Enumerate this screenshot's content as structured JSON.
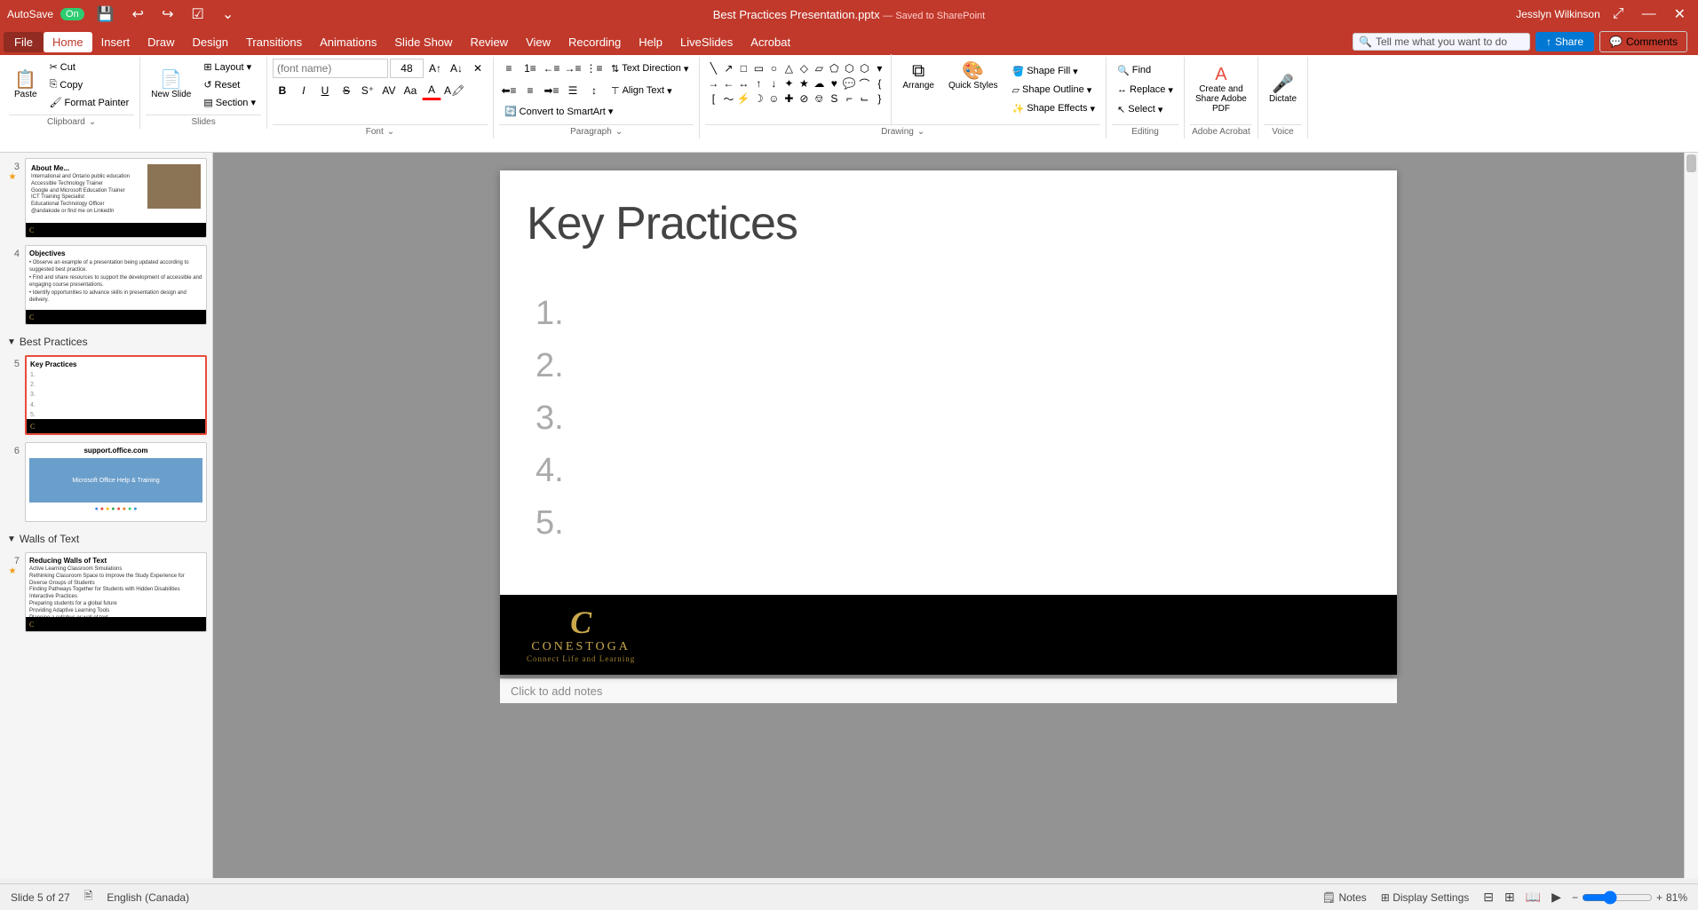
{
  "titlebar": {
    "autosave_label": "AutoSave",
    "autosave_state": "On",
    "file_title": "Best Practices Presentation.pptx",
    "saved_state": "Saved to SharePoint",
    "user_name": "Jesslyn Wilkinson"
  },
  "menu": {
    "file": "File",
    "home": "Home",
    "insert": "Insert",
    "draw": "Draw",
    "design": "Design",
    "transitions": "Transitions",
    "animations": "Animations",
    "slideshow": "Slide Show",
    "review": "Review",
    "view": "View",
    "recording": "Recording",
    "help": "Help",
    "liveslides": "LiveSlides",
    "acrobat": "Acrobat"
  },
  "ribbon": {
    "search_placeholder": "Tell me what you want to do",
    "groups": {
      "clipboard": {
        "label": "Clipboard",
        "paste": "Paste",
        "cut": "Cut",
        "copy": "Copy",
        "format_painter": "Format Painter"
      },
      "slides": {
        "label": "Slides",
        "new_slide": "New Slide",
        "layout": "Layout",
        "reset": "Reset",
        "section": "Section"
      },
      "font": {
        "label": "Font",
        "bold": "B",
        "italic": "I",
        "underline": "U",
        "strikethrough": "S",
        "font_name": "",
        "font_size": "48"
      },
      "paragraph": {
        "label": "Paragraph",
        "text_direction": "Text Direction",
        "align_text": "Align Text",
        "convert_smartart": "Convert to SmartArt"
      },
      "drawing": {
        "label": "Drawing",
        "arrange": "Arrange",
        "quick_styles": "Quick Styles",
        "shape_fill": "Shape Fill",
        "shape_outline": "Shape Outline",
        "shape_effects": "Shape Effects"
      },
      "editing": {
        "label": "Editing",
        "find": "Find",
        "replace": "Replace",
        "select": "Select"
      },
      "adobe_acrobat": {
        "label": "Adobe Acrobat",
        "create_share": "Create and Share Adobe PDF"
      },
      "voice": {
        "label": "Voice",
        "dictate": "Dictate"
      }
    }
  },
  "slides": {
    "section_best_practices": "Best Practices",
    "section_walls_of_text": "Walls of Text",
    "current_slide": 5,
    "total_slides": 27,
    "items": [
      {
        "num": "3",
        "has_star": true,
        "title": "About Me...",
        "content": "International and Ontario public education\nAccessible Technology Trainer\nGoogle and Microsoft Education Trainer\nICT Training Specialist\nEducational Technology Officer\n@andakode or find me on LinkedIn"
      },
      {
        "num": "4",
        "has_star": false,
        "title": "Objectives",
        "content": "Observe an example of a presentation being updated according to suggested best practice.\nFind and share resources to support the development of accessible and engaging course presentations.\nIdentify opportunities to advance skills in presentation design and delivery."
      },
      {
        "num": "5",
        "has_star": false,
        "title": "Key Practices",
        "content": "1.\n2.\n3.\n4.\n5.",
        "active": true
      },
      {
        "num": "6",
        "has_star": false,
        "title": "support.office.com",
        "content": "website screenshot"
      },
      {
        "num": "7",
        "has_star": true,
        "title": "Reducing Walls of Text",
        "content": "Active Learning Classroom Simulations\nRethinking Classroom Space to Improve the Study Experience for Diverse Groups of Students\nFinding Pathways Together for Students with Hidden Disabilities\nInteractive Practices\nPreparing students for a global future\nProviding Adaptive Learning Tools\nPlanning a syllabus or wall of text"
      }
    ]
  },
  "slide_main": {
    "title": "Key Practices",
    "list_items": [
      "1.",
      "2.",
      "3.",
      "4.",
      "5."
    ]
  },
  "footer": {
    "company_letter": "C",
    "company_name": "CONESTOGA",
    "company_tagline": "Connect Life and Learning"
  },
  "notes": {
    "placeholder": "Click to add notes"
  },
  "statusbar": {
    "slide_info": "Slide 5 of 27",
    "language": "English (Canada)",
    "notes_label": "Notes",
    "display_settings": "Display Settings",
    "zoom": "81%"
  }
}
